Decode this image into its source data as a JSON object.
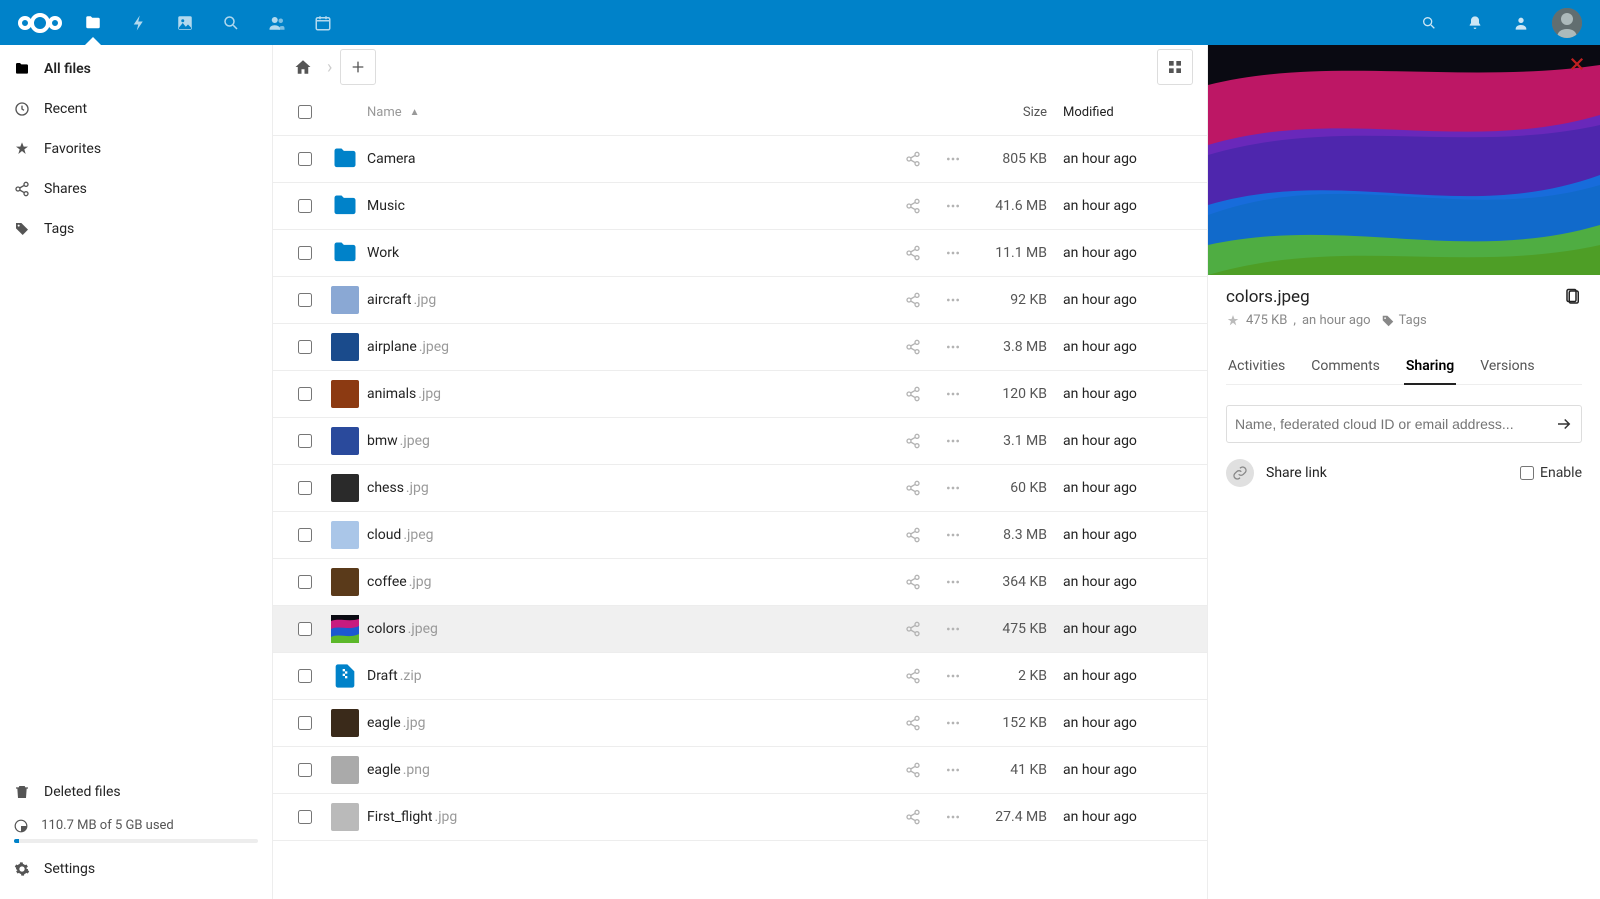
{
  "colors": {
    "brand": "#0082c9"
  },
  "topbar_icons": [
    "files",
    "bolt",
    "gallery",
    "search",
    "contacts",
    "calendar"
  ],
  "topbar_right_icons": [
    "search",
    "bell",
    "users"
  ],
  "sidebar": {
    "items": [
      {
        "label": "All files",
        "icon": "folder-solid",
        "active": true
      },
      {
        "label": "Recent",
        "icon": "clock"
      },
      {
        "label": "Favorites",
        "icon": "star"
      },
      {
        "label": "Shares",
        "icon": "share"
      },
      {
        "label": "Tags",
        "icon": "tag"
      }
    ],
    "deleted_label": "Deleted files",
    "quota_text": "110.7 MB of 5 GB used",
    "settings_label": "Settings"
  },
  "controls": {
    "grid_view": false
  },
  "table": {
    "headers": {
      "name": "Name",
      "size": "Size",
      "modified": "Modified"
    },
    "sort_asc_on": "name",
    "rows": [
      {
        "type": "folder",
        "name": "Camera",
        "ext": "",
        "size": "805 KB",
        "modified": "an hour ago",
        "thumb": "folder"
      },
      {
        "type": "folder",
        "name": "Music",
        "ext": "",
        "size": "41.6 MB",
        "modified": "an hour ago",
        "thumb": "folder"
      },
      {
        "type": "folder",
        "name": "Work",
        "ext": "",
        "size": "11.1 MB",
        "modified": "an hour ago",
        "thumb": "folder"
      },
      {
        "type": "image",
        "name": "aircraft",
        "ext": ".jpg",
        "size": "92 KB",
        "modified": "an hour ago",
        "thumb": "#8aa8d4"
      },
      {
        "type": "image",
        "name": "airplane",
        "ext": ".jpeg",
        "size": "3.8 MB",
        "modified": "an hour ago",
        "thumb": "#1a4b8c"
      },
      {
        "type": "image",
        "name": "animals",
        "ext": ".jpg",
        "size": "120 KB",
        "modified": "an hour ago",
        "thumb": "#8c3a12"
      },
      {
        "type": "image",
        "name": "bmw",
        "ext": ".jpeg",
        "size": "3.1 MB",
        "modified": "an hour ago",
        "thumb": "#2a4a9c"
      },
      {
        "type": "image",
        "name": "chess",
        "ext": ".jpg",
        "size": "60 KB",
        "modified": "an hour ago",
        "thumb": "#2a2a2a"
      },
      {
        "type": "image",
        "name": "cloud",
        "ext": ".jpeg",
        "size": "8.3 MB",
        "modified": "an hour ago",
        "thumb": "#aac6e8"
      },
      {
        "type": "image",
        "name": "coffee",
        "ext": ".jpg",
        "size": "364 KB",
        "modified": "an hour ago",
        "thumb": "#5a3a1a"
      },
      {
        "type": "image",
        "name": "colors",
        "ext": ".jpeg",
        "size": "475 KB",
        "modified": "an hour ago",
        "thumb": "colors",
        "selected": true
      },
      {
        "type": "zip",
        "name": "Draft",
        "ext": ".zip",
        "size": "2 KB",
        "modified": "an hour ago",
        "thumb": "zip"
      },
      {
        "type": "image",
        "name": "eagle",
        "ext": ".jpg",
        "size": "152 KB",
        "modified": "an hour ago",
        "thumb": "#3a2a1a"
      },
      {
        "type": "image",
        "name": "eagle",
        "ext": ".png",
        "size": "41 KB",
        "modified": "an hour ago",
        "thumb": "#aaa"
      },
      {
        "type": "image",
        "name": "First_flight",
        "ext": ".jpg",
        "size": "27.4 MB",
        "modified": "an hour ago",
        "thumb": "#bababa"
      }
    ]
  },
  "details": {
    "title": "colors.jpeg",
    "size": "475 KB",
    "sep": ", ",
    "modified": "an hour ago",
    "tags_label": "Tags",
    "tabs": [
      {
        "label": "Activities"
      },
      {
        "label": "Comments"
      },
      {
        "label": "Sharing",
        "active": true
      },
      {
        "label": "Versions"
      }
    ],
    "share_placeholder": "Name, federated cloud ID or email address...",
    "share_link_label": "Share link",
    "enable_label": "Enable"
  }
}
